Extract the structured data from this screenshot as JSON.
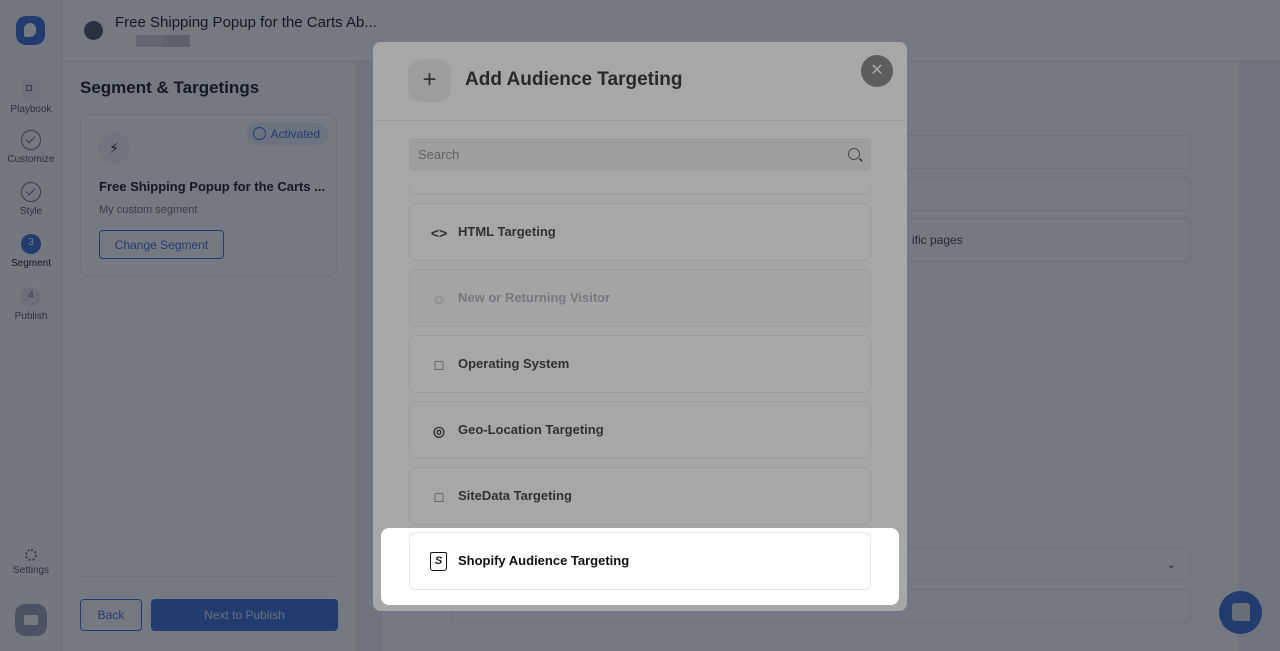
{
  "app": {
    "title": "Free Shipping Popup for the Carts Ab...",
    "brand_color": "#3b6fd4"
  },
  "rail": {
    "items": [
      {
        "label": "Playbook",
        "icon": "grid-icon",
        "state": "default"
      },
      {
        "label": "Customize",
        "icon": "check-circle-icon",
        "state": "done"
      },
      {
        "label": "Style",
        "icon": "check-circle-icon",
        "state": "done"
      },
      {
        "label": "Segment",
        "step": "3",
        "state": "active"
      },
      {
        "label": "Publish",
        "step": "4",
        "state": "pending"
      }
    ],
    "settings_label": "Settings"
  },
  "left_panel": {
    "title": "Segment & Targetings",
    "segment": {
      "status": "Activated",
      "name": "Free Shipping Popup for the Carts ...",
      "description": "My custom segment",
      "change_button": "Change Segment"
    },
    "back_button": "Back",
    "next_button": "Next to Publish"
  },
  "canvas": {
    "visible_fragment": "ific pages"
  },
  "modal": {
    "title": "Add Audience Targeting",
    "search_placeholder": "Search",
    "items": [
      {
        "label": "HTML Targeting",
        "icon": "code-icon",
        "disabled": false
      },
      {
        "label": "New or Returning Visitor",
        "icon": "users-icon",
        "disabled": true
      },
      {
        "label": "Operating System",
        "icon": "laptop-gear-icon",
        "disabled": false
      },
      {
        "label": "Geo-Location Targeting",
        "icon": "map-pin-icon",
        "disabled": false
      },
      {
        "label": "SiteData Targeting",
        "icon": "laptop-gear-icon",
        "disabled": false
      },
      {
        "label": "Shopify Audience Targeting",
        "icon": "shopify-bag-icon",
        "disabled": false,
        "highlighted": true
      }
    ]
  }
}
